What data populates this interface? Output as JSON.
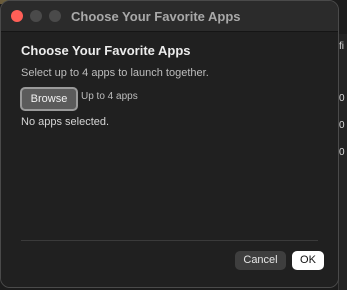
{
  "window": {
    "title": "Choose Your Favorite Apps"
  },
  "dialog": {
    "heading": "Choose Your Favorite Apps",
    "description": "Select up to 4 apps to launch together.",
    "browse_label": "Browse",
    "limit_label": "Up to 4 apps",
    "status": "No apps selected.",
    "cancel_label": "Cancel",
    "ok_label": "OK"
  },
  "background": {
    "edge_snippets": [
      "fi",
      "0",
      "0",
      "0"
    ]
  },
  "colors": {
    "close": "#ff5f57",
    "window_bg": "#202020",
    "ok_button": "#ffffff"
  }
}
